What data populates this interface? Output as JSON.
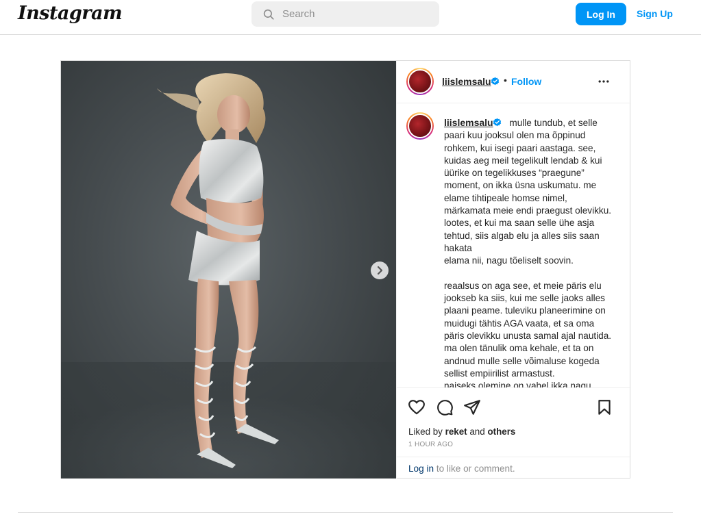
{
  "header": {
    "logo": "Instagram",
    "search_placeholder": "Search",
    "login_label": "Log In",
    "signup_label": "Sign Up"
  },
  "post": {
    "username": "liislemsalu",
    "follow_label": "Follow",
    "separator": "•",
    "caption": "mulle tundub, et selle paari kuu jooksul olen ma õppinud rohkem, kui isegi paari aastaga. see, kuidas aeg meil tegelikult lendab & kui üürike on tegelikkuses “praegune” moment, on ikka üsna uskumatu. me elame tihtipeale homse nimel, märkamata meie endi praegust olevikku. lootes, et kui ma saan selle ühe asja tehtud, siis algab elu ja alles siis saan hakata\nelama nii, nagu tõeliselt soovin.\n\nreaalsus on aga see, et meie päris elu jookseb ka siis, kui me selle jaoks alles plaani peame. tuleviku planeerimine on muidugi tähtis AGA vaata, et sa oma päris olevikku unusta samal ajal nautida. ma olen tänulik oma kehale, et ta on andnud mulle selle võimaluse kogeda sellist empiirilist armastust.\nnaiseks olemine on vahel ikka nagu",
    "likes_prefix": "Liked by",
    "likes_user": "reket",
    "likes_and": "and",
    "likes_others": "others",
    "timestamp": "1 HOUR AGO",
    "login_link": "Log in",
    "login_suffix": " to like or comment."
  },
  "colors": {
    "accent": "#0095f6",
    "border": "#dbdbdb",
    "muted": "#8e8e8e",
    "text": "#262626"
  },
  "icons": {
    "search": "search-icon",
    "next": "chevron-right-icon",
    "verified": "verified-badge-icon",
    "more": "more-options-icon",
    "like": "heart-icon",
    "comment": "comment-icon",
    "share": "paper-plane-icon",
    "save": "bookmark-icon"
  }
}
